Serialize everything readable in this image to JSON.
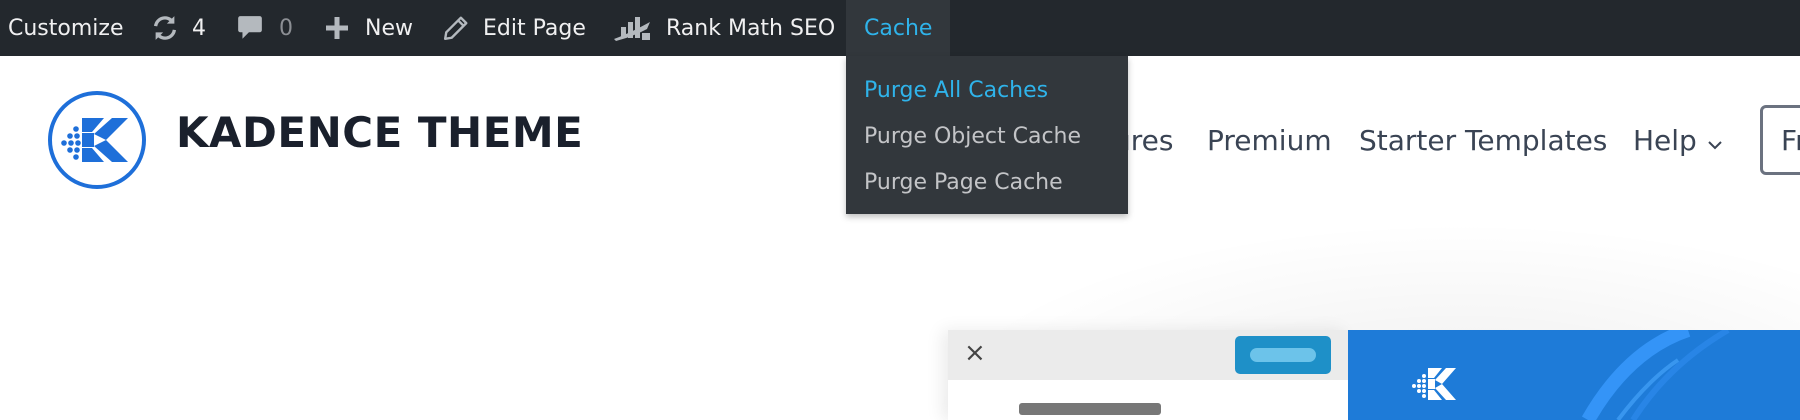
{
  "adminbar": {
    "customize": "Customize",
    "updates_count": "4",
    "comments_count": "0",
    "new_label": "New",
    "edit_page": "Edit Page",
    "rank_math": "Rank Math SEO",
    "cache": "Cache"
  },
  "cache_menu": {
    "items": [
      {
        "label": "Purge All Caches",
        "active": true
      },
      {
        "label": "Purge Object Cache",
        "active": false
      },
      {
        "label": "Purge Page Cache",
        "active": false
      }
    ]
  },
  "site": {
    "title": "KADENCE THEME"
  },
  "nav": {
    "items": [
      {
        "label": "ures"
      },
      {
        "label": "Premium"
      },
      {
        "label": "Starter Templates"
      },
      {
        "label": "Help"
      }
    ],
    "button_partial": "Fr"
  },
  "editor_preview": {
    "close_glyph": "×"
  },
  "colors": {
    "adminbar_bg": "#23282d",
    "submenu_bg": "#32373c",
    "accent_link": "#2fb3ea",
    "kadence_blue": "#1e6fd9",
    "title_text": "#1a202c"
  }
}
